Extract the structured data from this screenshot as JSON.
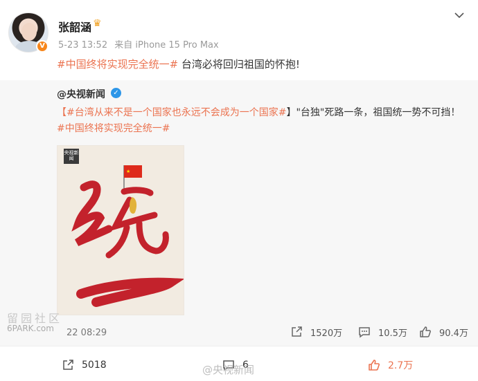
{
  "post": {
    "author": "张韶涵",
    "timestamp": "5-23 13:52",
    "source": "来自 iPhone 15 Pro Max",
    "hashtag": "#中国终将实现完全统一#",
    "text": " 台湾必将回归祖国的怀抱!",
    "verify_badge": "V"
  },
  "repost": {
    "author": "@央视新闻",
    "text_part1": "【",
    "hashtag1": "#台湾从来不是一个国家也永远不会成为一个国家#",
    "text_part2": "】\"台独\"死路一条，祖国统一势不可挡！",
    "hashtag2": "#中国终将实现完全统一#",
    "poster_logo": "央视新闻",
    "poster_text": "统一",
    "timestamp": "22 08:29",
    "stats": {
      "repost": "1520万",
      "comment": "10.5万",
      "like": "90.4万"
    }
  },
  "footer": {
    "repost": "5018",
    "comment": "6",
    "like": "2.7万"
  },
  "watermarks": {
    "left_cn": "留园社区",
    "left_en": "6PARK.com",
    "right": "@央视新闻"
  },
  "colors": {
    "accent": "#eb7350",
    "verified_blue": "#2d96e8",
    "verified_orange": "#f7861b"
  },
  "icons": [
    "chevron-down-icon",
    "repost-icon",
    "comment-icon",
    "like-icon",
    "crown-icon",
    "verified-icon"
  ]
}
